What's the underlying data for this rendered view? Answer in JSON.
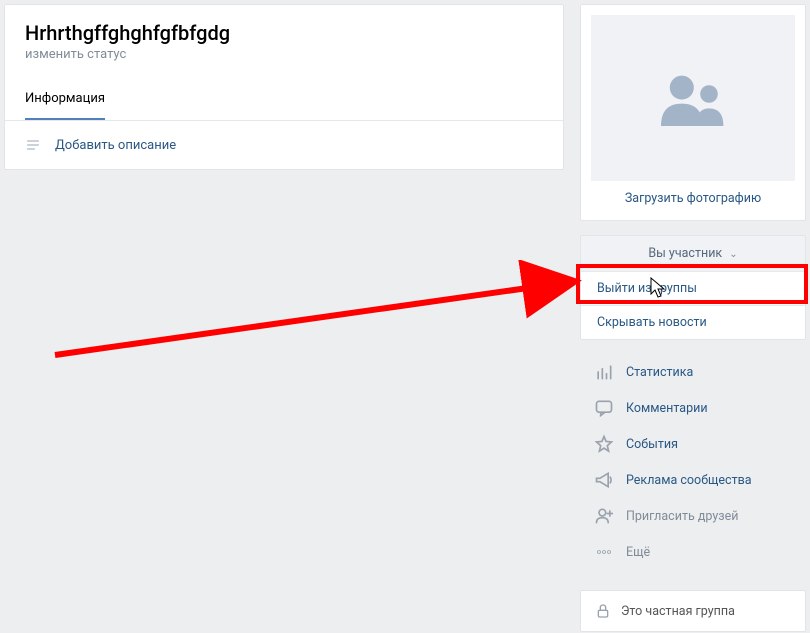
{
  "group": {
    "title": "Hrhrthgffghghfgfbfgdg",
    "status_link": "изменить статус",
    "tab_info": "Информация",
    "add_description": "Добавить описание"
  },
  "sidebar": {
    "upload_photo": "Загрузить фотографию",
    "member_button": "Вы участник",
    "dropdown": {
      "leave": "Выйти из группы",
      "hide_news": "Скрывать новости"
    },
    "menu": {
      "stats": "Статистика",
      "comments": "Комментарии",
      "events": "События",
      "ads": "Реклама сообщества",
      "invite": "Пригласить друзей",
      "more": "Ещё"
    },
    "private_label": "Это частная группа"
  }
}
